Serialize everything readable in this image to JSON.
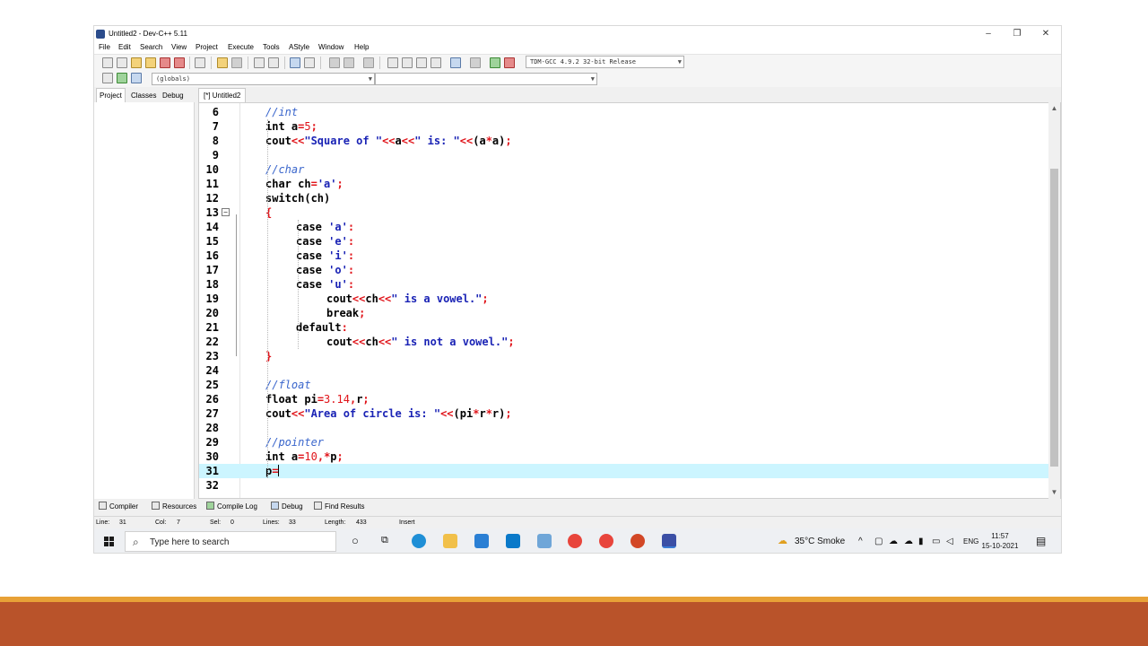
{
  "window": {
    "title": "Untitled2 - Dev-C++ 5.11",
    "minimize": "–",
    "restore": "❐",
    "close": "✕"
  },
  "menu": [
    "File",
    "Edit",
    "Search",
    "View",
    "Project",
    "Execute",
    "Tools",
    "AStyle",
    "Window",
    "Help"
  ],
  "toolbar": {
    "compiler_select": "TDM-GCC 4.9.2 32-bit Release",
    "globals_select": "(globals)"
  },
  "left_tabs": [
    "Project",
    "Classes",
    "Debug"
  ],
  "editor_tab": "[*] Untitled2",
  "code_lines": [
    {
      "n": "6"
    },
    {
      "n": "7"
    },
    {
      "n": "8"
    },
    {
      "n": "9"
    },
    {
      "n": "10"
    },
    {
      "n": "11"
    },
    {
      "n": "12"
    },
    {
      "n": "13"
    },
    {
      "n": "14"
    },
    {
      "n": "15"
    },
    {
      "n": "16"
    },
    {
      "n": "17"
    },
    {
      "n": "18"
    },
    {
      "n": "19"
    },
    {
      "n": "20"
    },
    {
      "n": "21"
    },
    {
      "n": "22"
    },
    {
      "n": "23"
    },
    {
      "n": "24"
    },
    {
      "n": "25"
    },
    {
      "n": "26"
    },
    {
      "n": "27"
    },
    {
      "n": "28"
    },
    {
      "n": "29"
    },
    {
      "n": "30"
    },
    {
      "n": "31"
    },
    {
      "n": "32"
    }
  ],
  "code": {
    "l6": "//int",
    "l7_kw": "int",
    "l7_a": " a",
    "l7_eq": "=",
    "l7_num": "5",
    "l7_semi": ";",
    "l8_fn": "cout",
    "l8_op1": "<<",
    "l8_str1": "\"Square of \"",
    "l8_op2": "<<",
    "l8_a": "a",
    "l8_op3": "<<",
    "l8_str2": "\" is: \"",
    "l8_op4": "<<",
    "l8_p": "(a",
    "l8_mul": "*",
    "l8_p2": "a)",
    "l8_semi": ";",
    "l10": "//char",
    "l11_kw": "char",
    "l11_rest": " ch",
    "l11_eq": "=",
    "l11_str": "'a'",
    "l11_semi": ";",
    "l12_kw": "switch",
    "l12_rest": "(ch)",
    "l13": "{",
    "case_kw": "case",
    "l14": "'a'",
    "l15": "'e'",
    "l16": "'i'",
    "l17": "'o'",
    "l18": "'u'",
    "colon": ":",
    "l19_fn": "cout",
    "l19_op1": "<<",
    "l19_ch": "ch",
    "l19_op2": "<<",
    "l19_str": "\" is a vowel.\"",
    "l19_semi": ";",
    "l20_kw": "break",
    "l20_semi": ";",
    "l21_kw": "default",
    "l21_colon": ":",
    "l22_fn": "cout",
    "l22_op1": "<<",
    "l22_ch": "ch",
    "l22_op2": "<<",
    "l22_str": "\" is not a vowel.\"",
    "l22_semi": ";",
    "l23": "}",
    "l25": "//float",
    "l26_kw": "float",
    "l26_a": " pi",
    "l26_eq": "=",
    "l26_num": "3.14",
    "l26_comma": ",",
    "l26_r": "r",
    "l26_semi": ";",
    "l27_fn": "cout",
    "l27_op1": "<<",
    "l27_str": "\"Area of circle is: \"",
    "l27_op2": "<<",
    "l27_p": "(pi",
    "l27_mul": "*",
    "l27_r": "r",
    "l27_mul2": "*",
    "l27_r2": "r)",
    "l27_semi": ";",
    "l29": "//pointer",
    "l30_kw": "int",
    "l30_a": " a",
    "l30_eq": "=",
    "l30_num": "10",
    "l30_comma": ",",
    "l30_star": "*",
    "l30_p": "p",
    "l30_semi": ";",
    "l31_p": "p",
    "l31_eq": "="
  },
  "bottom_tabs": [
    "Compiler",
    "Resources",
    "Compile Log",
    "Debug",
    "Find Results"
  ],
  "status": {
    "line_label": "Line:",
    "line": "31",
    "col_label": "Col:",
    "col": "7",
    "sel_label": "Sel:",
    "sel": "0",
    "lines_label": "Lines:",
    "lines": "33",
    "length_label": "Length:",
    "length": "433",
    "mode": "Insert"
  },
  "taskbar": {
    "search_placeholder": "Type here to search",
    "weather": "35°C  Smoke",
    "lang": "ENG",
    "time": "11:57",
    "date": "15-10-2021"
  },
  "colors": {
    "current_line": "#ccf5ff",
    "keyword": "#000000",
    "comment": "#3a66cc",
    "string": "#1a23b5",
    "number_symbol": "#e0141a",
    "footer": "#b9532a",
    "footer_stripe": "#e8a137"
  }
}
